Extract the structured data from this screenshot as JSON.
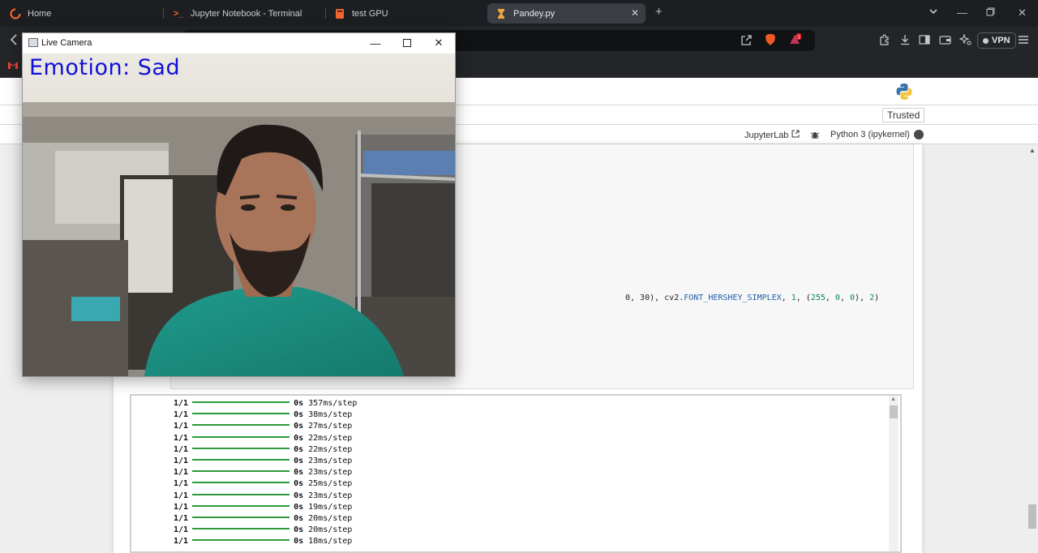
{
  "browser": {
    "tabs": [
      {
        "label": "Home"
      },
      {
        "label": "Jupyter Notebook - Terminal"
      },
      {
        "label": "test GPU"
      },
      {
        "label": "Pandey.py"
      }
    ],
    "vpn_label": "VPN",
    "notification_count": "1"
  },
  "notebook": {
    "trusted_label": "Trusted",
    "jupyterlab_label": "JupyterLab",
    "kernel_label": "Python 3 (ipykernel)",
    "code_line": {
      "p1": "0, 30), cv2.",
      "p2": "FONT_HERSHEY_SIMPLEX",
      "p3": ", ",
      "p4": "1",
      "p5": ", (",
      "p6": "255",
      "p7": ", ",
      "p8": "0",
      "p9": ", ",
      "p10": "0",
      "p11": "), ",
      "p12": "2",
      "p13": ")"
    },
    "output_lines": [
      {
        "step": "1/1",
        "time": "0s",
        "rate": "357ms/step"
      },
      {
        "step": "1/1",
        "time": "0s",
        "rate": "38ms/step"
      },
      {
        "step": "1/1",
        "time": "0s",
        "rate": "27ms/step"
      },
      {
        "step": "1/1",
        "time": "0s",
        "rate": "22ms/step"
      },
      {
        "step": "1/1",
        "time": "0s",
        "rate": "22ms/step"
      },
      {
        "step": "1/1",
        "time": "0s",
        "rate": "23ms/step"
      },
      {
        "step": "1/1",
        "time": "0s",
        "rate": "23ms/step"
      },
      {
        "step": "1/1",
        "time": "0s",
        "rate": "25ms/step"
      },
      {
        "step": "1/1",
        "time": "0s",
        "rate": "23ms/step"
      },
      {
        "step": "1/1",
        "time": "0s",
        "rate": "19ms/step"
      },
      {
        "step": "1/1",
        "time": "0s",
        "rate": "20ms/step"
      },
      {
        "step": "1/1",
        "time": "0s",
        "rate": "20ms/step"
      },
      {
        "step": "1/1",
        "time": "0s",
        "rate": "18ms/step"
      }
    ]
  },
  "camera_window": {
    "title": "Live Camera",
    "emotion_text": "Emotion: Sad"
  },
  "colors": {
    "emotion_text": "#1010d8",
    "progress_bar": "#2e9a3a"
  }
}
